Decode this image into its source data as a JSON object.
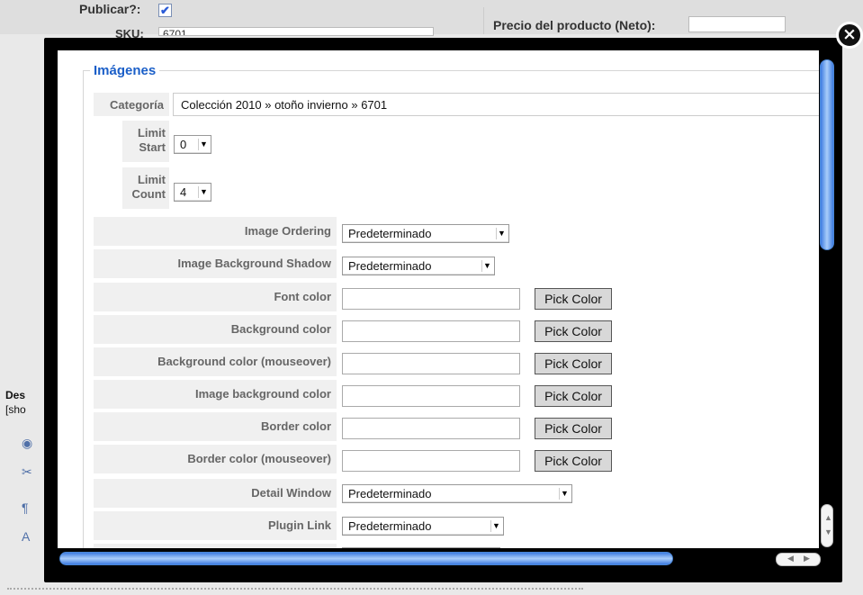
{
  "background": {
    "publicar_label": "Publicar?:",
    "publicar_checked": true,
    "sku_label": "SKU:",
    "sku_value": "6701",
    "precio_label": "Precio del producto (Neto):",
    "desc_title": "Des",
    "desc_sub": "[sho"
  },
  "modal": {
    "legend": "Imágenes",
    "categoria": {
      "label": "Categoría",
      "value": "Colección 2010 » otoño invierno » 6701"
    },
    "limit_start": {
      "label1": "Limit",
      "label2": "Start",
      "value": "0"
    },
    "limit_count": {
      "label1": "Limit",
      "label2": "Count",
      "value": "4"
    },
    "image_ordering": {
      "label": "Image Ordering",
      "value": "Predeterminado"
    },
    "image_bg_shadow": {
      "label": "Image Background Shadow",
      "value": "Predeterminado"
    },
    "font_color": {
      "label": "Font color",
      "value": ""
    },
    "background_color": {
      "label": "Background color",
      "value": ""
    },
    "background_color_mouseover": {
      "label": "Background color (mouseover)",
      "value": ""
    },
    "image_background_color": {
      "label": "Image background color",
      "value": ""
    },
    "border_color": {
      "label": "Border color",
      "value": ""
    },
    "border_color_mouseover": {
      "label": "Border color (mouseover)",
      "value": ""
    },
    "detail_window": {
      "label": "Detail Window",
      "value": "Predeterminado"
    },
    "plugin_link": {
      "label": "Plugin Link",
      "value": "Predeterminado"
    },
    "pick_color_label": "Pick Color"
  },
  "colors": {
    "legend": "#1b5fc8",
    "label_bg": "#f0f0f0",
    "scroll_thumb": "#3d7be0"
  }
}
